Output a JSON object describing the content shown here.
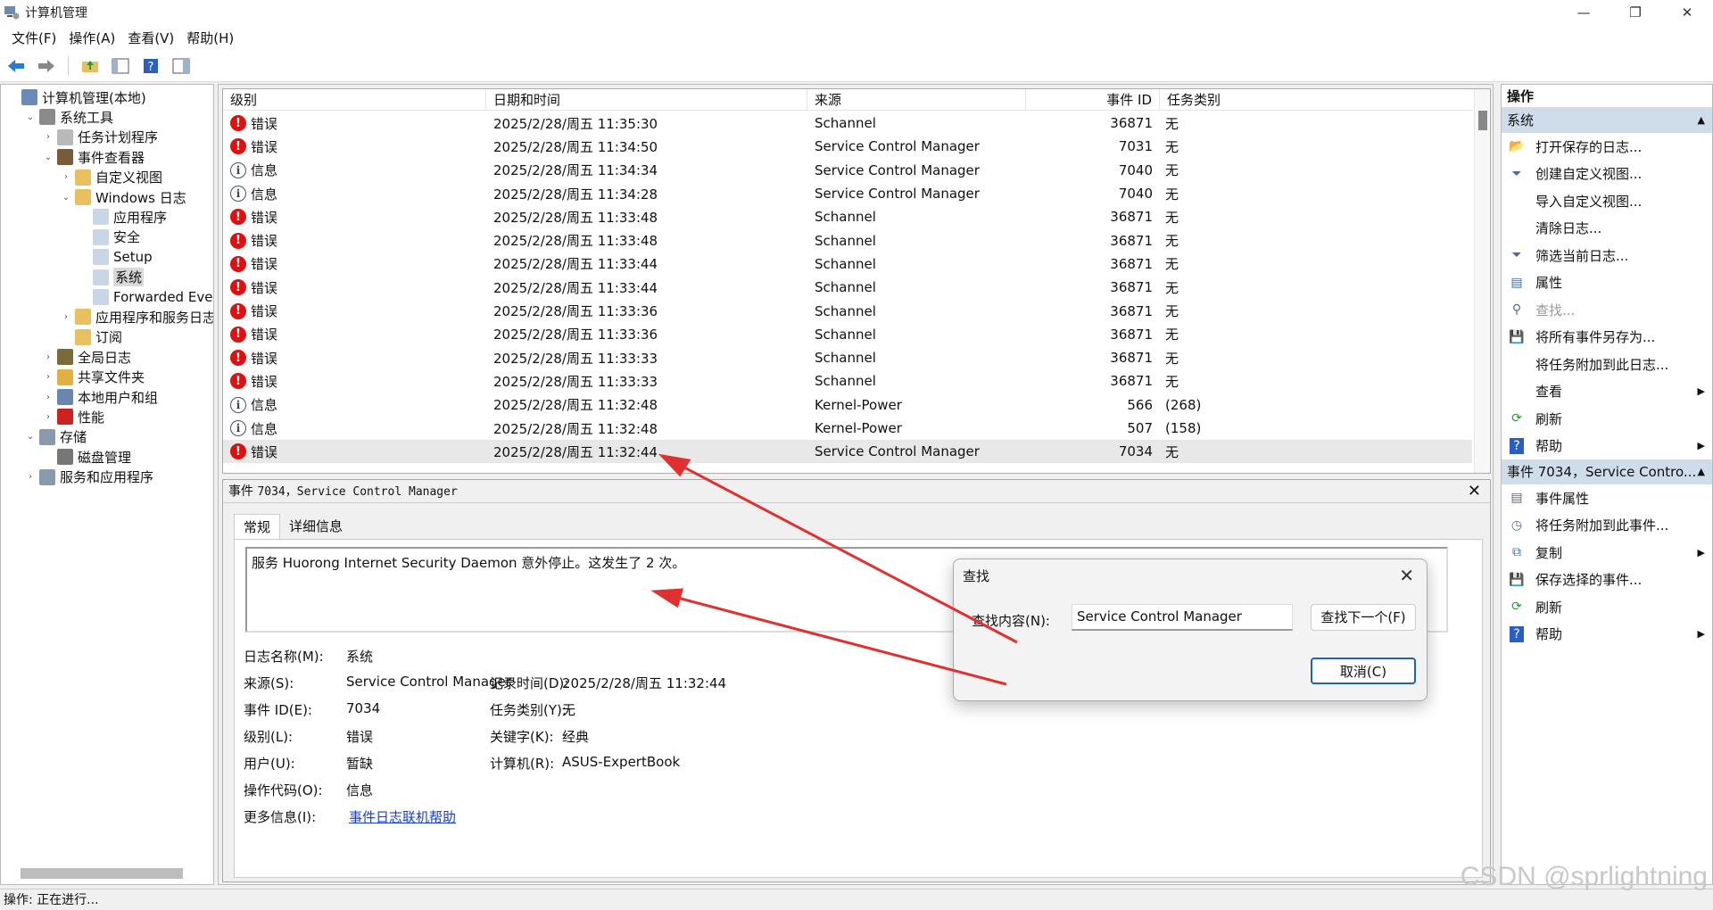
{
  "window": {
    "title": "计算机管理",
    "min": "—",
    "max": "❐",
    "close": "✕"
  },
  "menu": [
    "文件(F)",
    "操作(A)",
    "查看(V)",
    "帮助(H)"
  ],
  "tree": [
    {
      "label": "计算机管理(本地)",
      "level": 0,
      "arrow": "",
      "icon": "computer-management-icon",
      "color": "#6b8bb5"
    },
    {
      "label": "系统工具",
      "level": 1,
      "arrow": "⌄",
      "icon": "system-tools-icon",
      "color": "#8a8a8a"
    },
    {
      "label": "任务计划程序",
      "level": 2,
      "arrow": "›",
      "icon": "clock-icon",
      "color": "#b9b9b9"
    },
    {
      "label": "事件查看器",
      "level": 2,
      "arrow": "⌄",
      "icon": "event-viewer-icon",
      "color": "#7b5a3a"
    },
    {
      "label": "自定义视图",
      "level": 3,
      "arrow": "›",
      "icon": "folder-icon",
      "color": "#e8c060"
    },
    {
      "label": "Windows 日志",
      "level": 3,
      "arrow": "⌄",
      "icon": "folder-icon",
      "color": "#e8c060"
    },
    {
      "label": "应用程序",
      "level": 4,
      "arrow": "",
      "icon": "log-icon",
      "color": "#c9d6e6"
    },
    {
      "label": "安全",
      "level": 4,
      "arrow": "",
      "icon": "log-icon",
      "color": "#c9d6e6"
    },
    {
      "label": "Setup",
      "level": 4,
      "arrow": "",
      "icon": "log-icon",
      "color": "#c9d6e6"
    },
    {
      "label": "系统",
      "level": 4,
      "arrow": "",
      "icon": "log-icon",
      "color": "#c9d6e6",
      "selected": true
    },
    {
      "label": "Forwarded Even",
      "level": 4,
      "arrow": "",
      "icon": "log-icon",
      "color": "#c9d6e6"
    },
    {
      "label": "应用程序和服务日志",
      "level": 3,
      "arrow": "›",
      "icon": "folder-icon",
      "color": "#e8c060"
    },
    {
      "label": "订阅",
      "level": 3,
      "arrow": "",
      "icon": "folder-icon",
      "color": "#e8c060"
    },
    {
      "label": "全局日志",
      "level": 2,
      "arrow": "›",
      "icon": "global-log-icon",
      "color": "#7b6a3a"
    },
    {
      "label": "共享文件夹",
      "level": 2,
      "arrow": "›",
      "icon": "shared-folder-icon",
      "color": "#e0b040"
    },
    {
      "label": "本地用户和组",
      "level": 2,
      "arrow": "›",
      "icon": "users-icon",
      "color": "#6a86b0"
    },
    {
      "label": "性能",
      "level": 2,
      "arrow": "›",
      "icon": "performance-icon",
      "color": "#cc2222"
    },
    {
      "label": "存储",
      "level": 1,
      "arrow": "⌄",
      "icon": "storage-icon",
      "color": "#8a9aae"
    },
    {
      "label": "磁盘管理",
      "level": 2,
      "arrow": "",
      "icon": "disk-icon",
      "color": "#777"
    },
    {
      "label": "服务和应用程序",
      "level": 1,
      "arrow": "›",
      "icon": "services-icon",
      "color": "#8a9aae"
    }
  ],
  "grid": {
    "headers": [
      "级别",
      "日期和时间",
      "来源",
      "事件 ID",
      "任务类别"
    ],
    "rows": [
      {
        "level": "错误",
        "type": "error",
        "date": "2025/2/28/周五 11:35:30",
        "source": "Schannel",
        "id": "36871",
        "cat": "无"
      },
      {
        "level": "错误",
        "type": "error",
        "date": "2025/2/28/周五 11:34:50",
        "source": "Service Control Manager",
        "id": "7031",
        "cat": "无"
      },
      {
        "level": "信息",
        "type": "info",
        "date": "2025/2/28/周五 11:34:34",
        "source": "Service Control Manager",
        "id": "7040",
        "cat": "无"
      },
      {
        "level": "信息",
        "type": "info",
        "date": "2025/2/28/周五 11:34:28",
        "source": "Service Control Manager",
        "id": "7040",
        "cat": "无"
      },
      {
        "level": "错误",
        "type": "error",
        "date": "2025/2/28/周五 11:33:48",
        "source": "Schannel",
        "id": "36871",
        "cat": "无"
      },
      {
        "level": "错误",
        "type": "error",
        "date": "2025/2/28/周五 11:33:48",
        "source": "Schannel",
        "id": "36871",
        "cat": "无"
      },
      {
        "level": "错误",
        "type": "error",
        "date": "2025/2/28/周五 11:33:44",
        "source": "Schannel",
        "id": "36871",
        "cat": "无"
      },
      {
        "level": "错误",
        "type": "error",
        "date": "2025/2/28/周五 11:33:44",
        "source": "Schannel",
        "id": "36871",
        "cat": "无"
      },
      {
        "level": "错误",
        "type": "error",
        "date": "2025/2/28/周五 11:33:36",
        "source": "Schannel",
        "id": "36871",
        "cat": "无"
      },
      {
        "level": "错误",
        "type": "error",
        "date": "2025/2/28/周五 11:33:36",
        "source": "Schannel",
        "id": "36871",
        "cat": "无"
      },
      {
        "level": "错误",
        "type": "error",
        "date": "2025/2/28/周五 11:33:33",
        "source": "Schannel",
        "id": "36871",
        "cat": "无"
      },
      {
        "level": "错误",
        "type": "error",
        "date": "2025/2/28/周五 11:33:33",
        "source": "Schannel",
        "id": "36871",
        "cat": "无"
      },
      {
        "level": "信息",
        "type": "info",
        "date": "2025/2/28/周五 11:32:48",
        "source": "Kernel-Power",
        "id": "566",
        "cat": "(268)"
      },
      {
        "level": "信息",
        "type": "info",
        "date": "2025/2/28/周五 11:32:48",
        "source": "Kernel-Power",
        "id": "507",
        "cat": "(158)"
      },
      {
        "level": "错误",
        "type": "error",
        "date": "2025/2/28/周五 11:32:44",
        "source": "Service Control Manager",
        "id": "7034",
        "cat": "无",
        "selected": true
      }
    ]
  },
  "detail": {
    "title_prefix": "事件",
    "title_mono": "7034，Service Control Manager",
    "close": "✕",
    "tabs": [
      "常规",
      "详细信息"
    ],
    "description": "服务 Huorong Internet Security Daemon 意外停止。这发生了 2 次。",
    "props": {
      "log_name_label": "日志名称(M):",
      "log_name": "系统",
      "source_label": "来源(S):",
      "source": "Service Control Manager",
      "logged_label": "记录时间(D):",
      "logged": "2025/2/28/周五 11:32:44",
      "event_id_label": "事件 ID(E):",
      "event_id": "7034",
      "task_label": "任务类别(Y):",
      "task": "无",
      "level_label": "级别(L):",
      "level": "错误",
      "keywords_label": "关键字(K):",
      "keywords": "经典",
      "user_label": "用户(U):",
      "user": "暂缺",
      "computer_label": "计算机(R):",
      "computer": "ASUS-ExpertBook",
      "opcode_label": "操作代码(O):",
      "opcode": "信息",
      "more_label": "更多信息(I):",
      "more_link": "事件日志联机帮助"
    }
  },
  "actions": {
    "header": "操作",
    "section1": "系统",
    "items1": [
      {
        "label": "打开保存的日志...",
        "icon": "📂",
        "sub": false
      },
      {
        "label": "创建自定义视图...",
        "icon": "⏷",
        "sub": false
      },
      {
        "label": "导入自定义视图...",
        "icon": "",
        "sub": false
      },
      {
        "label": "清除日志...",
        "icon": "",
        "sub": false
      },
      {
        "label": "筛选当前日志...",
        "icon": "⏷",
        "sub": false
      },
      {
        "label": "属性",
        "icon": "▤",
        "sub": false
      },
      {
        "label": "查找...",
        "icon": "⚲",
        "sub": false,
        "disabled": true
      },
      {
        "label": "将所有事件另存为...",
        "icon": "💾",
        "sub": false
      },
      {
        "label": "将任务附加到此日志...",
        "icon": "",
        "sub": false
      },
      {
        "label": "查看",
        "icon": "",
        "sub": true
      },
      {
        "label": "刷新",
        "icon": "⟳",
        "sub": false
      },
      {
        "label": "帮助",
        "icon": "?",
        "sub": true
      }
    ],
    "section2": "事件 7034，Service Contro...",
    "items2": [
      {
        "label": "事件属性",
        "icon": "▤",
        "sub": false
      },
      {
        "label": "将任务附加到此事件...",
        "icon": "◷",
        "sub": false
      },
      {
        "label": "复制",
        "icon": "⧉",
        "sub": true
      },
      {
        "label": "保存选择的事件...",
        "icon": "💾",
        "sub": false
      },
      {
        "label": "刷新",
        "icon": "⟳",
        "sub": false
      },
      {
        "label": "帮助",
        "icon": "?",
        "sub": true
      }
    ]
  },
  "find_dialog": {
    "title": "查找",
    "label": "查找内容(N):",
    "value": "Service Control Manager",
    "find_next": "查找下一个(F)",
    "cancel": "取消(C)",
    "close": "✕"
  },
  "status": "操作: 正在进行...",
  "watermark": "CSDN @sprlightning",
  "colors": {
    "error": "#d11111",
    "info_border": "#445566",
    "section_bg": "#cfdcea",
    "link": "#1a40c8",
    "annotation_arrow": "#e03030"
  }
}
